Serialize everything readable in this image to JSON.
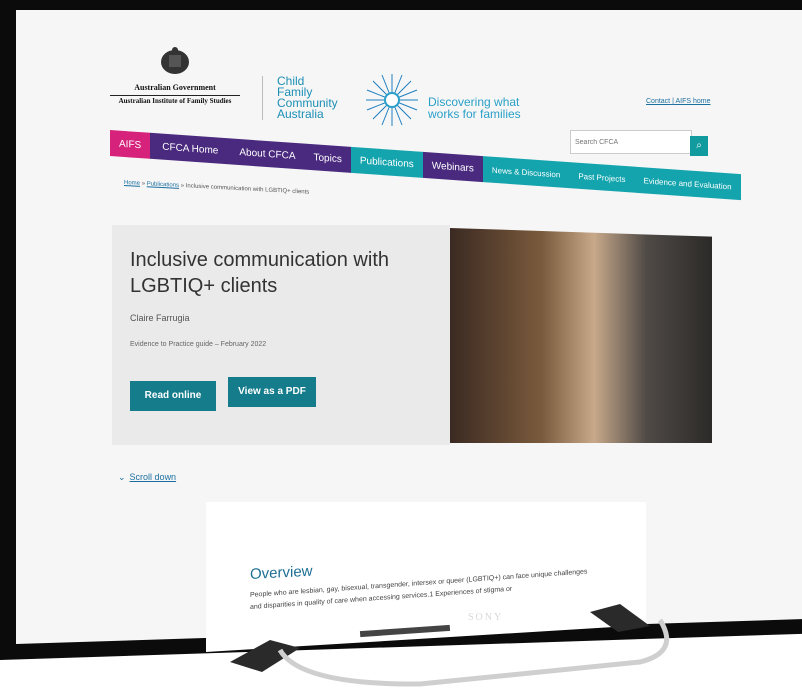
{
  "gov": {
    "name": "Australian Government",
    "institute": "Australian Institute of Family Studies"
  },
  "cfca": {
    "name_lines": [
      "Child",
      "Family",
      "Community",
      "Australia"
    ],
    "tagline": "Discovering what works for families"
  },
  "toplinks": {
    "contact": "Contact",
    "sep": "|",
    "home": "AIFS home"
  },
  "search": {
    "placeholder": "Search CFCA",
    "icon": "search-icon"
  },
  "nav": {
    "items": [
      {
        "label": "AIFS",
        "color": "#d6227b"
      },
      {
        "label": "CFCA Home",
        "color": "#4a2a7e"
      },
      {
        "label": "About CFCA",
        "color": "#4a2a7e"
      },
      {
        "label": "Topics",
        "color": "#4a2a7e"
      },
      {
        "label": "Publications",
        "color": "#13a4ad"
      },
      {
        "label": "Webinars",
        "color": "#4a2a7e"
      },
      {
        "label": "News & Discussion",
        "color": "#13a4ad"
      },
      {
        "label": "Past Projects",
        "color": "#13a4ad"
      },
      {
        "label": "Evidence and Evaluation",
        "color": "#13a4ad"
      }
    ]
  },
  "breadcrumb": {
    "home": "Home",
    "sep": "»",
    "publications": "Publications",
    "current": "Inclusive communication with LGBTIQ+ clients"
  },
  "hero": {
    "title": "Inclusive communication with LGBTIQ+ clients",
    "author": "Claire Farrugia",
    "meta": "Evidence to Practice guide – February 2022",
    "read_online": "Read online",
    "view_pdf": "View as a PDF"
  },
  "scroll": {
    "label": "Scroll down",
    "icon": "chevron-down-icon"
  },
  "overview": {
    "title": "Overview",
    "text": "People who are lesbian, gay, bisexual, transgender, intersex or queer (LGBTIQ+) can face unique challenges and disparities in quality of care when accessing services.1 Experiences of stigma or"
  },
  "tv": {
    "brand": "SONY"
  },
  "colors": {
    "teal": "#157c8c",
    "purple": "#4a2a7e",
    "magenta": "#d6227b",
    "link": "#1b6fa0"
  }
}
